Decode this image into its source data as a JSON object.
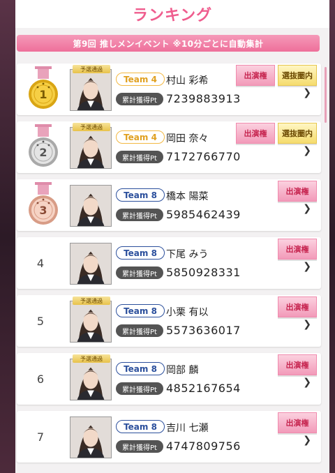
{
  "header": {
    "title": "ランキング"
  },
  "banner": {
    "text": "第9回 推しメンイベント ※10分ごとに自動集計"
  },
  "labels": {
    "pt_label": "累計獲得Pt",
    "qualifier": "予選通過",
    "appearance": "出演権",
    "selection": "選抜圏内"
  },
  "colors": {
    "accent": "#ef5d8e",
    "team4": "#f3b842",
    "team8": "#2b4f9c"
  },
  "ranking": [
    {
      "rank": "1",
      "medal": "gold",
      "team": "Team 4",
      "name": "村山 彩希",
      "points": "7239883913",
      "qualified": true,
      "appearance": true,
      "selection": true
    },
    {
      "rank": "2",
      "medal": "silver",
      "team": "Team 4",
      "name": "岡田 奈々",
      "points": "7172766770",
      "qualified": true,
      "appearance": true,
      "selection": true
    },
    {
      "rank": "3",
      "medal": "bronze",
      "team": "Team 8",
      "name": "橋本 陽菜",
      "points": "5985462439",
      "qualified": false,
      "appearance": true,
      "selection": false
    },
    {
      "rank": "4",
      "medal": "",
      "team": "Team 8",
      "name": "下尾 みう",
      "points": "5850928331",
      "qualified": false,
      "appearance": true,
      "selection": false
    },
    {
      "rank": "5",
      "medal": "",
      "team": "Team 8",
      "name": "小栗 有以",
      "points": "5573636017",
      "qualified": true,
      "appearance": true,
      "selection": false
    },
    {
      "rank": "6",
      "medal": "",
      "team": "Team 8",
      "name": "岡部 麟",
      "points": "4852167654",
      "qualified": true,
      "appearance": true,
      "selection": false
    },
    {
      "rank": "7",
      "medal": "",
      "team": "Team 8",
      "name": "吉川 七瀬",
      "points": "4747809756",
      "qualified": false,
      "appearance": true,
      "selection": false
    }
  ]
}
